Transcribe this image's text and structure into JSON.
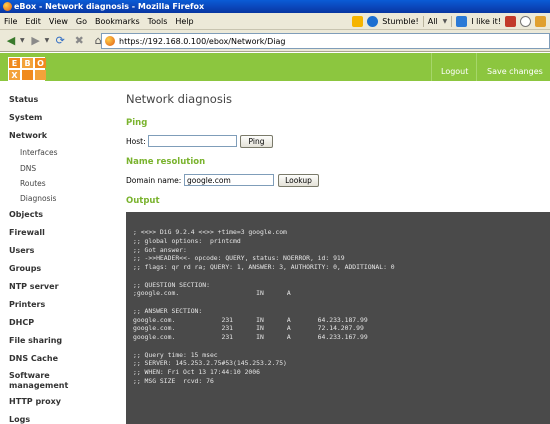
{
  "window": {
    "title": "eBox - Network diagnosis - Mozilla Firefox"
  },
  "menubar": {
    "items": [
      "File",
      "Edit",
      "View",
      "Go",
      "Bookmarks",
      "Tools",
      "Help"
    ],
    "stumble_label": "Stumble!",
    "all_label": "All",
    "like_label": "I like it!"
  },
  "navbar": {
    "url": "https://192.168.0.100/ebox/Network/Diag"
  },
  "header": {
    "logo": [
      "E",
      "B",
      "O",
      "X",
      "",
      ""
    ],
    "logout_label": "Logout",
    "save_label": "Save changes",
    "brand_color": "#8cc63f"
  },
  "sidebar": {
    "items": [
      {
        "label": "Status"
      },
      {
        "label": "System"
      },
      {
        "label": "Network"
      },
      {
        "label": "Interfaces"
      },
      {
        "label": "DNS"
      },
      {
        "label": "Routes"
      },
      {
        "label": "Diagnosis"
      },
      {
        "label": "Objects"
      },
      {
        "label": "Firewall"
      },
      {
        "label": "Users"
      },
      {
        "label": "Groups"
      },
      {
        "label": "NTP server"
      },
      {
        "label": "Printers"
      },
      {
        "label": "DHCP"
      },
      {
        "label": "File sharing"
      },
      {
        "label": "DNS Cache"
      },
      {
        "label": "Software management"
      },
      {
        "label": "HTTP proxy"
      },
      {
        "label": "Logs"
      }
    ]
  },
  "main": {
    "title": "Network diagnosis",
    "ping": {
      "heading": "Ping",
      "host_label": "Host:",
      "host_value": "",
      "button": "Ping"
    },
    "resolution": {
      "heading": "Name resolution",
      "domain_label": "Domain name:",
      "domain_value": "google.com",
      "button": "Lookup"
    },
    "output": {
      "heading": "Output",
      "lines": [
        "; <<>> DiG 9.2.4 <<>> +time=3 google.com",
        ";; global options:  printcmd",
        ";; Got answer:",
        ";; ->>HEADER<<- opcode: QUERY, status: NOERROR, id: 919",
        ";; flags: qr rd ra; QUERY: 1, ANSWER: 3, AUTHORITY: 0, ADDITIONAL: 0",
        "",
        ";; QUESTION SECTION:",
        ";google.com.                    IN      A",
        "",
        ";; ANSWER SECTION:",
        "google.com.            231      IN      A       64.233.187.99",
        "google.com.            231      IN      A       72.14.207.99",
        "google.com.            231      IN      A       64.233.167.99",
        "",
        ";; Query time: 15 msec",
        ";; SERVER: 145.253.2.75#53(145.253.2.75)",
        ";; WHEN: Fri Oct 13 17:44:10 2006",
        ";; MSG SIZE  rcvd: 76"
      ]
    }
  }
}
